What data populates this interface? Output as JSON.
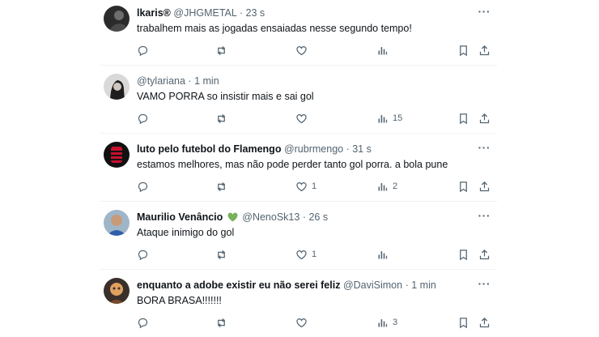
{
  "tweets": [
    {
      "name": "lkaris®",
      "handle": "@JHGMETAL",
      "time": "23 s",
      "text": "trabalhem mais as jogadas ensaiadas nesse segundo tempo!",
      "has_emoji": false,
      "counts": {
        "replies": "",
        "retweets": "",
        "likes": "",
        "views": ""
      }
    },
    {
      "name": "",
      "handle": "@tylariana",
      "time": "1 min",
      "text": "VAMO PORRA so insistir mais e sai gol",
      "has_emoji": false,
      "counts": {
        "replies": "",
        "retweets": "",
        "likes": "",
        "views": "15"
      }
    },
    {
      "name": "luto pelo futebol do Flamengo",
      "handle": "@rubrmengo",
      "time": "31 s",
      "text": "estamos melhores, mas não pode perder tanto gol porra. a bola pune",
      "has_emoji": false,
      "counts": {
        "replies": "",
        "retweets": "",
        "likes": "1",
        "views": "2"
      }
    },
    {
      "name": "Maurilio Venâncio",
      "handle": "@NenoSk13",
      "time": "26 s",
      "text": "Ataque inimigo do gol",
      "has_emoji": true,
      "emoji": "green-heart",
      "counts": {
        "replies": "",
        "retweets": "",
        "likes": "1",
        "views": ""
      }
    },
    {
      "name": "enquanto a adobe existir eu não serei feliz",
      "handle": "@DaviSimon",
      "time": "1 min",
      "text": "BORA BRASA!!!!!!!",
      "has_emoji": false,
      "counts": {
        "replies": "",
        "retweets": "",
        "likes": "",
        "views": "3"
      }
    }
  ],
  "separator": "·",
  "more_label": "···",
  "icons": {
    "reply": "reply-icon",
    "retweet": "retweet-icon",
    "like": "heart-icon",
    "views": "views-icon",
    "bookmark": "bookmark-icon",
    "share": "share-icon",
    "more": "more-icon"
  },
  "colors": {
    "text": "#0f1419",
    "secondary": "#536471",
    "divider": "#eff3f4",
    "heart_emoji": "#78b159"
  }
}
